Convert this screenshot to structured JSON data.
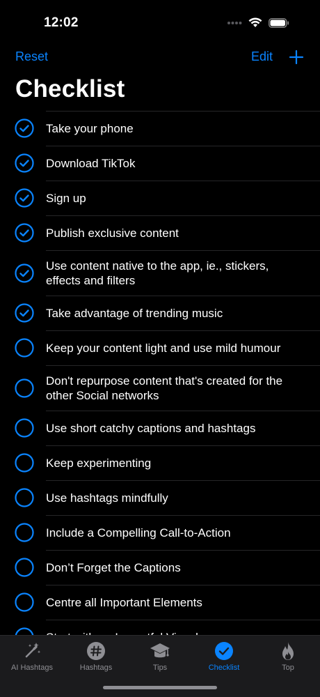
{
  "status": {
    "time": "12:02"
  },
  "nav": {
    "reset_label": "Reset",
    "edit_label": "Edit"
  },
  "title": "Checklist",
  "items": [
    {
      "text": "Take your phone",
      "checked": true
    },
    {
      "text": "Download TikTok",
      "checked": true
    },
    {
      "text": "Sign up",
      "checked": true
    },
    {
      "text": "Publish exclusive content",
      "checked": true
    },
    {
      "text": "Use content native to the app, ie., stickers, effects and filters",
      "checked": true
    },
    {
      "text": "Take advantage of trending music",
      "checked": true
    },
    {
      "text": "Keep your content light and use mild humour",
      "checked": false
    },
    {
      "text": "Don't repurpose content that's created for the other Social networks",
      "checked": false
    },
    {
      "text": "Use short catchy captions and hashtags",
      "checked": false
    },
    {
      "text": "Keep experimenting",
      "checked": false
    },
    {
      "text": "Use hashtags mindfully",
      "checked": false
    },
    {
      "text": "Include a Compelling Call-to-Action",
      "checked": false
    },
    {
      "text": "Don’t Forget the Captions",
      "checked": false
    },
    {
      "text": "Centre all Important Elements",
      "checked": false
    },
    {
      "text": "Start with an Impactful Visual",
      "checked": false
    }
  ],
  "tabs": [
    {
      "label": "AI Hashtags",
      "icon": "magic-wand-icon",
      "active": false
    },
    {
      "label": "Hashtags",
      "icon": "hashtag-icon",
      "active": false
    },
    {
      "label": "Tips",
      "icon": "graduation-cap-icon",
      "active": false
    },
    {
      "label": "Checklist",
      "icon": "checkmark-circle-icon",
      "active": true
    },
    {
      "label": "Top",
      "icon": "flame-icon",
      "active": false
    }
  ],
  "colors": {
    "accent": "#0a84ff",
    "background": "#000000",
    "tab_inactive": "#8e8e93",
    "tab_bar": "#1c1c1e"
  }
}
